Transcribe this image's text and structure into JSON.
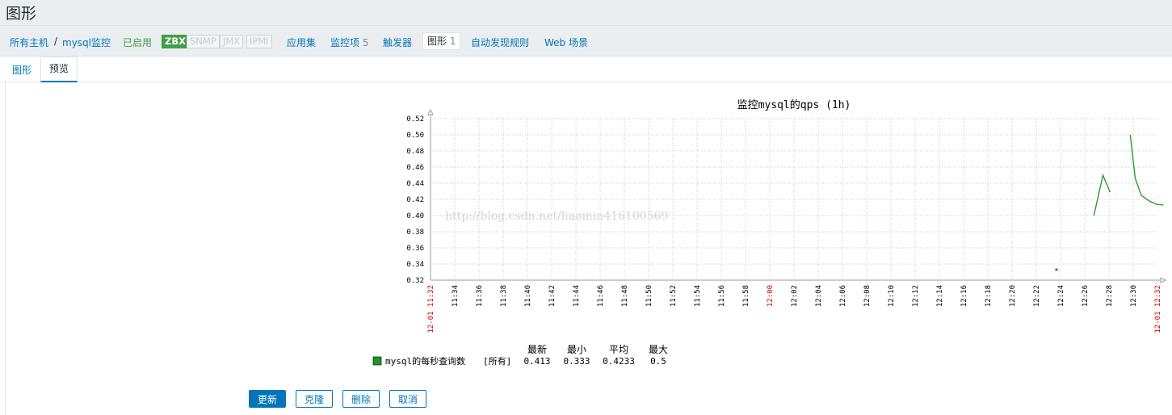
{
  "page": {
    "title": "图形"
  },
  "nav": {
    "all_hosts": "所有主机",
    "separator": "/",
    "host": "mysql监控",
    "status": "已启用",
    "tags": [
      "ZBX",
      "SNMP",
      "JMX",
      "IPMI"
    ],
    "applications": "应用集",
    "items_label": "监控项",
    "items_count": "5",
    "triggers": "触发器",
    "graphs_label": "图形",
    "graphs_count": "1",
    "discovery": "自动发现规则",
    "web": "Web 场景"
  },
  "tabs": {
    "graph": "图形",
    "preview": "预览"
  },
  "colors": {
    "accent": "#0275b8",
    "series": "#1a9a1a",
    "zbx": "#429e47",
    "time_marker": "#cc0000"
  },
  "chart_data": {
    "type": "line",
    "title": "监控mysql的qps (1h)",
    "ylim": [
      0.32,
      0.52
    ],
    "yticks": [
      "0.52",
      "0.50",
      "0.48",
      "0.46",
      "0.44",
      "0.42",
      "0.40",
      "0.38",
      "0.36",
      "0.34",
      "0.32"
    ],
    "x_start": "12-01 11:32",
    "x_end": "12-01 12:32",
    "x_ticks": [
      "11:34",
      "11:36",
      "11:38",
      "11:40",
      "11:42",
      "11:44",
      "11:46",
      "11:48",
      "11:50",
      "11:52",
      "11:54",
      "11:56",
      "11:58",
      "12:00",
      "12:02",
      "12:04",
      "12:06",
      "12:08",
      "12:10",
      "12:12",
      "12:14",
      "12:16",
      "12:18",
      "12:20",
      "12:22",
      "12:24",
      "12:26",
      "12:28",
      "12:30"
    ],
    "highlight_tick": "12:00",
    "watermark": "http://blog.csdn.net/liaomin416100569",
    "series": [
      {
        "name": "mysql的每秒查询数",
        "segments": [
          [
            [
              "12:23:40",
              0.333
            ]
          ],
          [
            [
              "12:26:45",
              0.4
            ],
            [
              "12:27:30",
              0.45
            ],
            [
              "12:28:05",
              0.429
            ]
          ],
          [
            [
              "12:29:45",
              0.5
            ],
            [
              "12:30:10",
              0.446
            ],
            [
              "12:30:40",
              0.425
            ],
            [
              "12:31:20",
              0.418
            ],
            [
              "12:31:55",
              0.414
            ],
            [
              "12:32:30",
              0.413
            ]
          ]
        ]
      }
    ],
    "legend": {
      "headers": [
        "最新",
        "最小",
        "平均",
        "最大"
      ],
      "entries": [
        {
          "name": "mysql的每秒查询数",
          "scope": "[所有]",
          "last": "0.413",
          "min": "0.333",
          "avg": "0.4233",
          "max": "0.5"
        }
      ]
    }
  },
  "buttons": {
    "update": "更新",
    "clone": "克隆",
    "delete": "删除",
    "cancel": "取消"
  }
}
